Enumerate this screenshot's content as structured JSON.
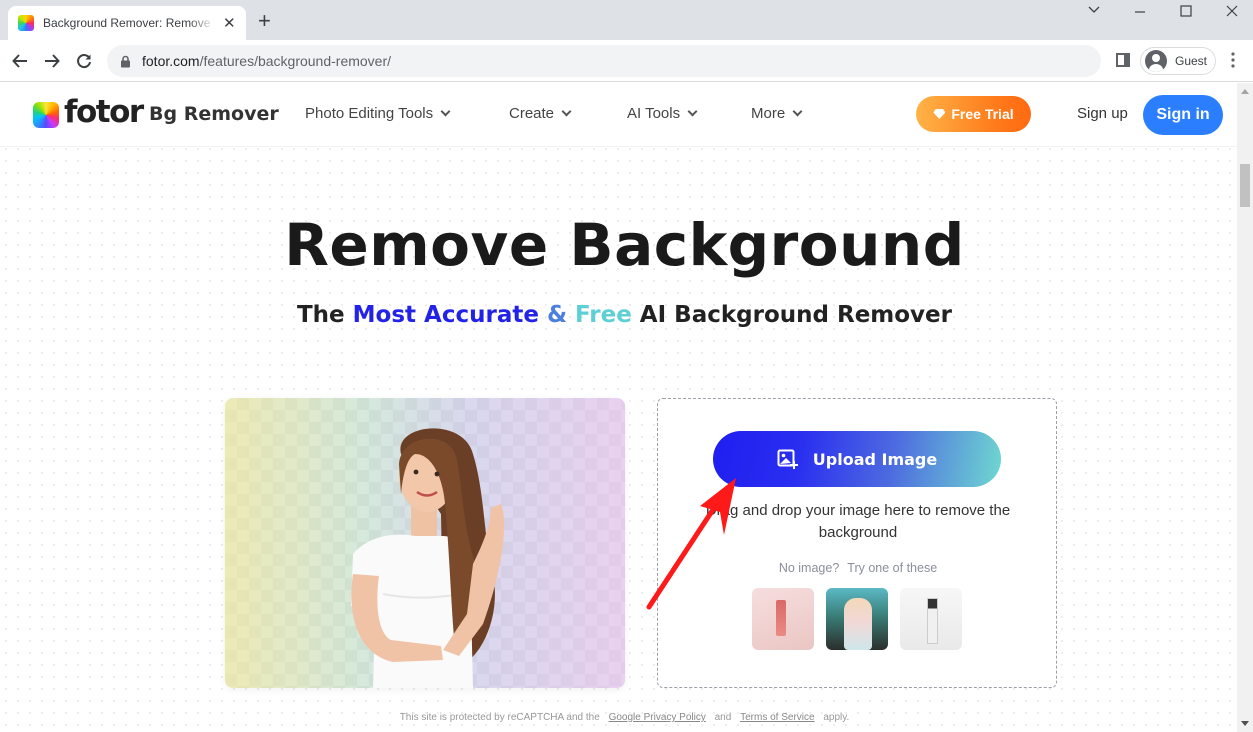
{
  "browser": {
    "tab_title": "Background Remover: Remove Background",
    "tab_close": "✕",
    "new_tab": "+",
    "url_host": "fotor.com",
    "url_path": "/features/background-remover/",
    "profile_name": "Guest",
    "window_controls": {
      "dropdown": "⌄",
      "minimize": "—",
      "maximize": "☐",
      "close": "✕"
    },
    "menu_glyph": "⋮"
  },
  "header": {
    "logo_text": "fotor",
    "product_name": "Bg Remover",
    "nav": [
      {
        "label": "Photo Editing Tools"
      },
      {
        "label": "Create"
      },
      {
        "label": "AI Tools"
      },
      {
        "label": "More"
      }
    ],
    "free_trial": "Free Trial",
    "sign_up": "Sign up",
    "sign_in": "Sign in",
    "colors": {
      "free_trial_start": "#ffb347",
      "free_trial_end": "#ff6a10",
      "sign_in": "#2b7fff"
    }
  },
  "hero": {
    "title": "Remove Background",
    "subtitle_parts": [
      "The ",
      "Most Accurate",
      " & ",
      "Free",
      " AI Background Remover"
    ],
    "accent_colors": [
      "#2323e8",
      "#4b7fe0",
      "#5fcfd6"
    ]
  },
  "demo": {
    "image_alt": "Woman in white t-shirt with background removed"
  },
  "upload": {
    "button_label": "Upload Image",
    "drop_text": "Drag and drop your image here to remove the background",
    "no_image": "No image?",
    "try_these": "Try one of these",
    "samples": [
      {
        "alt": "Pink lip gloss bottle"
      },
      {
        "alt": "Woman with cap outdoors"
      },
      {
        "alt": "Perfume bottle"
      }
    ]
  },
  "footer_note": {
    "prefix": "This site is protected by reCAPTCHA and the",
    "privacy_link": "Google Privacy Policy",
    "middle": "and",
    "terms_link": "Terms of Service",
    "suffix": "apply."
  },
  "annotation": {
    "color": "#ff1a1a",
    "target": "Upload Image button"
  }
}
